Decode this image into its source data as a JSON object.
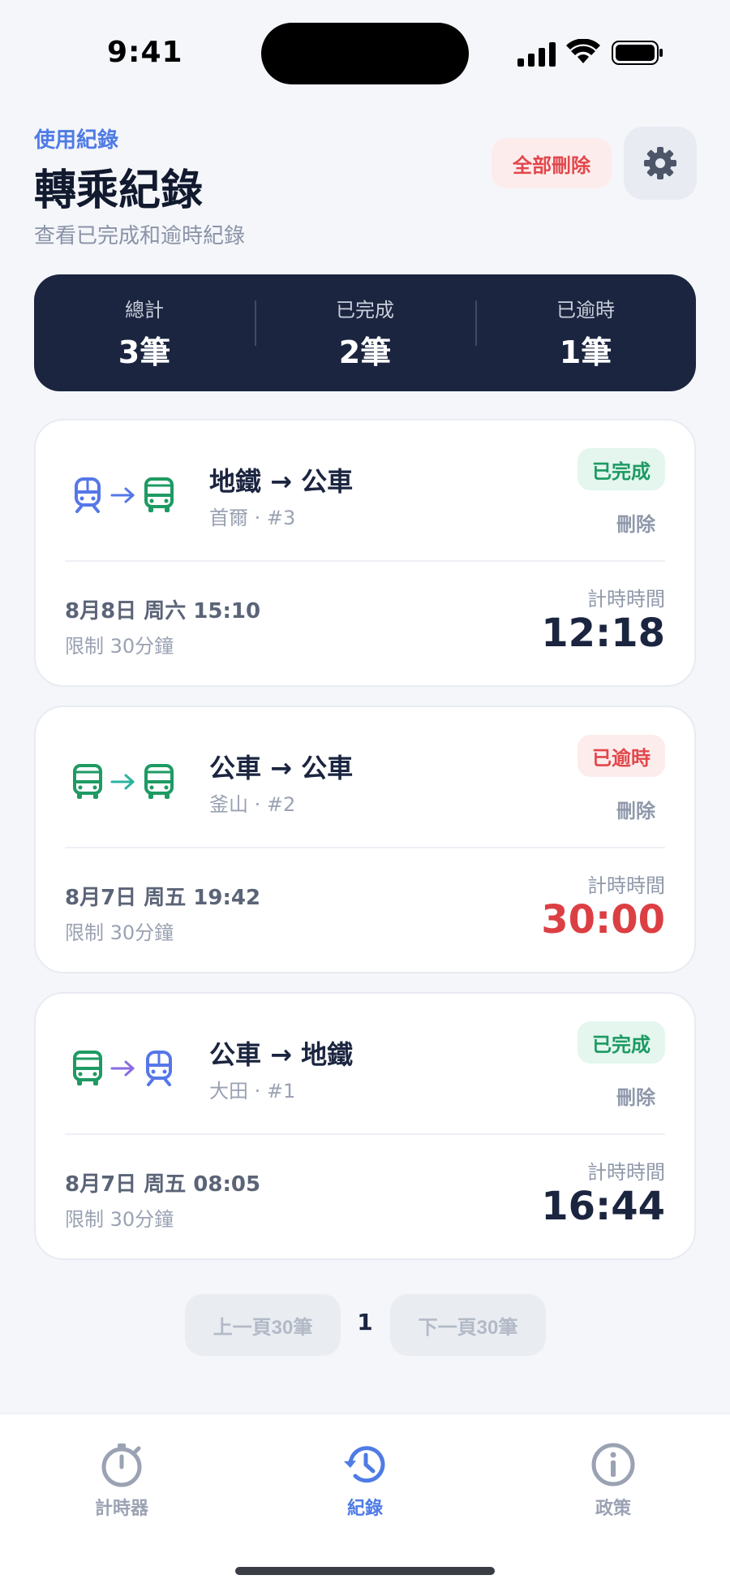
{
  "status_bar": {
    "time": "9:41"
  },
  "header": {
    "eyebrow": "使用紀錄",
    "title": "轉乘紀錄",
    "subtitle": "查看已完成和逾時紀錄",
    "delete_all_label": "全部刪除",
    "settings_icon": "gear-icon"
  },
  "summary": [
    {
      "label": "總計",
      "value": "3筆"
    },
    {
      "label": "已完成",
      "value": "2筆"
    },
    {
      "label": "已逾時",
      "value": "1筆"
    }
  ],
  "records": [
    {
      "from_icon": "subway-icon",
      "to_icon": "bus-icon",
      "title": "地鐵 → 公車",
      "subtitle": "首爾 · #3",
      "status": "已完成",
      "status_kind": "ok",
      "delete_label": "刪除",
      "date": "8月8日 周六 15:10",
      "limit": "限制 30分鐘",
      "timer_label": "計時時間",
      "timer_value": "12:18"
    },
    {
      "from_icon": "bus-icon",
      "to_icon": "bus-icon",
      "title": "公車 → 公車",
      "subtitle": "釜山 · #2",
      "status": "已逾時",
      "status_kind": "late",
      "delete_label": "刪除",
      "date": "8月7日 周五 19:42",
      "limit": "限制 30分鐘",
      "timer_label": "計時時間",
      "timer_value": "30:00"
    },
    {
      "from_icon": "bus-icon",
      "to_icon": "subway-icon",
      "title": "公車 → 地鐵",
      "subtitle": "大田 · #1",
      "status": "已完成",
      "status_kind": "ok",
      "delete_label": "刪除",
      "date": "8月7日 周五 08:05",
      "limit": "限制 30分鐘",
      "timer_label": "計時時間",
      "timer_value": "16:44"
    }
  ],
  "pagination": {
    "prev_label": "上一頁30筆",
    "page": "1",
    "next_label": "下一頁30筆"
  },
  "tabs": [
    {
      "label": "計時器",
      "icon": "stopwatch-icon",
      "active": false
    },
    {
      "label": "紀錄",
      "icon": "history-icon",
      "active": true
    },
    {
      "label": "政策",
      "icon": "info-icon",
      "active": false
    }
  ],
  "colors": {
    "accent": "#4f7be6",
    "subway": "#5577e8",
    "bus": "#1e9a63",
    "danger": "#e2474b",
    "dark": "#1b2540"
  }
}
